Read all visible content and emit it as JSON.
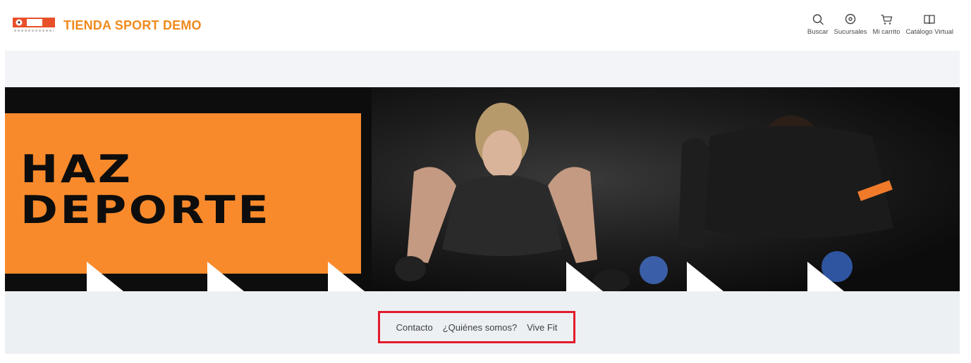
{
  "brand": {
    "name": "TIENDA SPORT DEMO",
    "accent": "#f08a1c"
  },
  "nav": {
    "items": [
      {
        "label": "Buscar",
        "icon": "search-icon"
      },
      {
        "label": "Sucursales",
        "icon": "location-pin-icon"
      },
      {
        "label": "Mi carrito",
        "icon": "cart-icon"
      },
      {
        "label": "Catálogo Virtual",
        "icon": "book-icon"
      }
    ]
  },
  "hero": {
    "title_line1": "HAZ",
    "title_line2": "DEPORTE",
    "accent": "#f98a2b"
  },
  "footer": {
    "links": [
      {
        "label": "Contacto"
      },
      {
        "label": "¿Quiénes somos?"
      },
      {
        "label": "Vive Fit"
      }
    ],
    "highlight_color": "#e21b2c"
  }
}
